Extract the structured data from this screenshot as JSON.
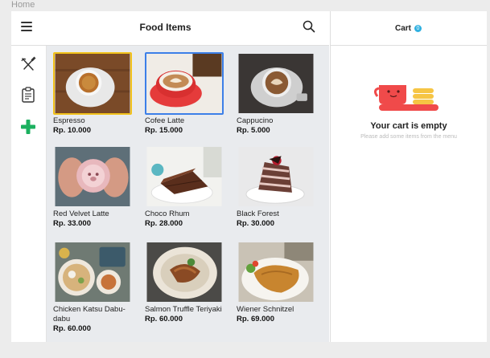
{
  "breadcrumb": {
    "home": "Home"
  },
  "header": {
    "title": "Food Items"
  },
  "side_nav": {
    "items": [
      {
        "icon": "utensils-icon"
      },
      {
        "icon": "clipboard-icon"
      },
      {
        "icon": "plus-icon",
        "color": "#1bb05f"
      }
    ]
  },
  "menu": {
    "items": [
      {
        "name": "Espresso",
        "price": "Rp. 10.000"
      },
      {
        "name": "Cofee Latte",
        "price": "Rp. 15.000"
      },
      {
        "name": "Cappucino",
        "price": "Rp. 5.000"
      },
      {
        "name": "Red Velvet Latte",
        "price": "Rp. 33.000"
      },
      {
        "name": "Choco Rhum",
        "price": "Rp. 28.000"
      },
      {
        "name": "Black Forest",
        "price": "Rp. 30.000"
      },
      {
        "name": "Chicken Katsu Dabu-dabu",
        "price": "Rp. 60.000"
      },
      {
        "name": "Salmon Truffle Teriyaki",
        "price": "Rp. 60.000"
      },
      {
        "name": "Wiener Schnitzel",
        "price": "Rp. 69.000"
      }
    ]
  },
  "cart": {
    "title": "Cart",
    "count": "0",
    "empty_title": "Your cart is empty",
    "empty_subtitle": "Please add some items from the menu"
  },
  "colors": {
    "accent_green": "#1bb05f",
    "badge_blue": "#2fb0e0",
    "selected_yellow": "#f2c21b",
    "selected_blue": "#3c7fe8",
    "cart_red": "#f04a4a",
    "cart_yellow": "#f6c544"
  }
}
